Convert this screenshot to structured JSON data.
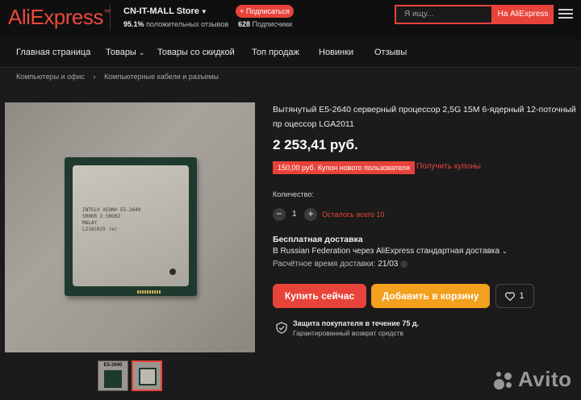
{
  "header": {
    "logo": "AliExpress",
    "store_name": "CN-IT-MALL Store",
    "rating_value": "95.1%",
    "rating_text": " положительных отзывов",
    "subscribe_label": "+ Подписаться",
    "subscribers_count": "628",
    "subscribers_text": " Подписчики",
    "search_placeholder": "Я ищу...",
    "search_button": "На AliExpress"
  },
  "nav": {
    "items": [
      {
        "label": "Главная страница"
      },
      {
        "label": "Товары"
      },
      {
        "label": "Товары со скидкой"
      },
      {
        "label": "Топ продаж"
      },
      {
        "label": "Новинки"
      },
      {
        "label": "Отзывы"
      }
    ]
  },
  "breadcrumb": {
    "items": [
      "Компьютеры и офис",
      "Компьютерные кабели и разъемы"
    ]
  },
  "image": {
    "cpu_label": "INTEL® XEON® E5-2640\nSR0KR 2.50GHZ\nMALAY\nL216C025 (e)",
    "thumb1_label": "E5-2640"
  },
  "product": {
    "title": "Вытянутый E5-2640 серверный процессор 2,5G 15M 6-ядерный 12-поточный пр оцессор LGA2011",
    "price": "2 253,41 руб.",
    "coupon_badge": "150,00 руб. Купон нового пользователя",
    "coupon_link": "Получить купоны",
    "quantity_label": "Количество:",
    "quantity_value": "1",
    "quantity_left": "Осталось всего 10",
    "shipping_title": "Бесплатная доставка",
    "shipping_line": "В Russian Federation через AliExpress стандартная доставка",
    "delivery_label": "Расчётное время доставки: ",
    "delivery_date": "21/03",
    "buy_now": "Купить сейчас",
    "add_to_cart": "Добавить в корзину",
    "wishlist_count": "1",
    "protection_title": "Защита покупателя в течение 75 д.",
    "protection_sub": "Гарантированный возврат средств"
  },
  "watermark": "Avito",
  "colors": {
    "accent": "#e8433a",
    "cart": "#f2a01e",
    "background": "#1b1b1b"
  }
}
